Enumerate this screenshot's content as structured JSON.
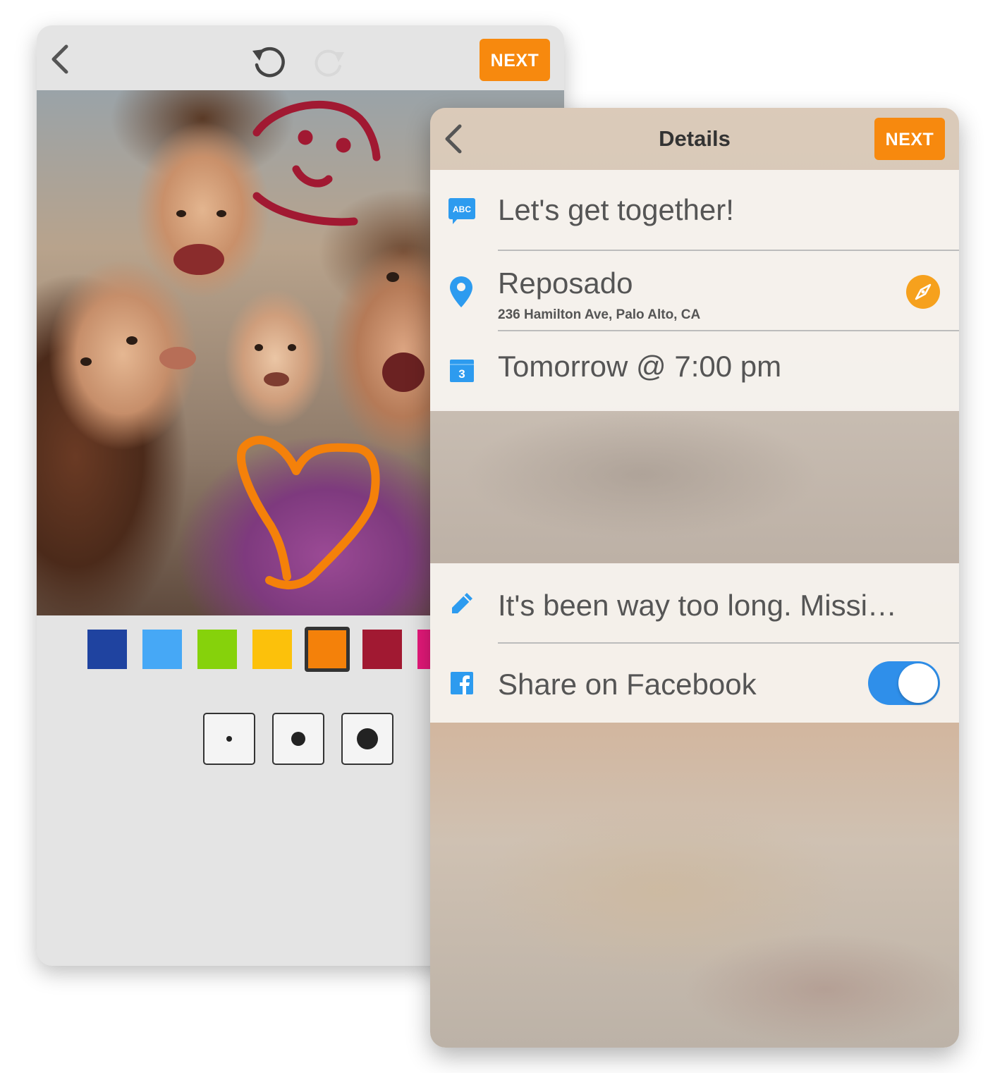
{
  "editor": {
    "next_label": "NEXT",
    "colors": [
      "#1f43a0",
      "#46a8f6",
      "#86d20b",
      "#fcc10b",
      "#f4810a",
      "#a11932",
      "#e5197a"
    ],
    "selected_color_index": 4,
    "brush_sizes": [
      "small",
      "medium",
      "large"
    ],
    "selected_brush_index": 1,
    "drawing_colors": {
      "smile": "#a11932",
      "heart": "#f4810a"
    }
  },
  "details": {
    "title": "Details",
    "next_label": "NEXT",
    "event_title": "Let's get together!",
    "location_name": "Reposado",
    "location_address": "236 Hamilton Ave, Palo Alto, CA",
    "datetime": "Tomorrow @ 7:00 pm",
    "calendar_day": "3",
    "message": "It's been way too long. Missi…",
    "share_label": "Share on Facebook",
    "share_enabled": true,
    "abc_icon_text": "ABC"
  },
  "colors": {
    "accent": "#f7890e",
    "icon_blue": "#2d9bef",
    "toggle_on": "#2f8fea",
    "locate": "#f6a11d"
  }
}
